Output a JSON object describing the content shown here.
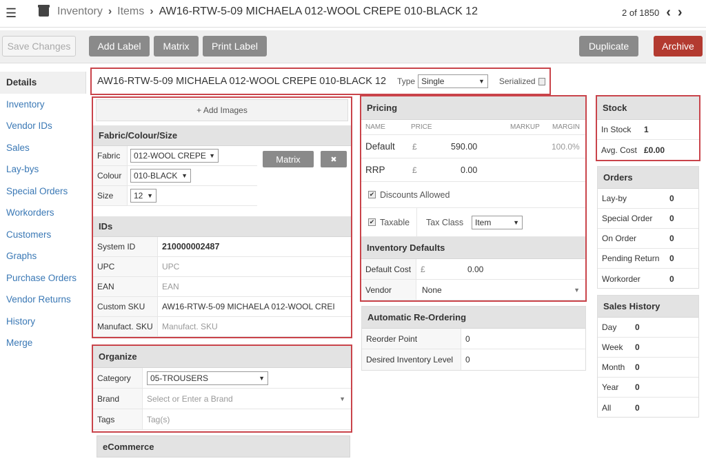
{
  "header": {
    "crumb_inventory": "Inventory",
    "crumb_items": "Items",
    "crumb_current": "AW16-RTW-5-09 MICHAELA 012-WOOL CREPE 010-BLACK 12",
    "pager": "2 of 1850"
  },
  "toolbar": {
    "save_label": "Save Changes",
    "add_label": "Add Label",
    "matrix_label": "Matrix",
    "print_label": "Print Label",
    "duplicate_label": "Duplicate",
    "archive_label": "Archive"
  },
  "sidebar": {
    "items": [
      {
        "label": "Details"
      },
      {
        "label": "Inventory"
      },
      {
        "label": "Vendor IDs"
      },
      {
        "label": "Sales"
      },
      {
        "label": "Lay-bys"
      },
      {
        "label": "Special Orders"
      },
      {
        "label": "Workorders"
      },
      {
        "label": "Customers"
      },
      {
        "label": "Graphs"
      },
      {
        "label": "Purchase Orders"
      },
      {
        "label": "Vendor Returns"
      },
      {
        "label": "History"
      },
      {
        "label": "Merge"
      }
    ]
  },
  "item": {
    "title": "AW16-RTW-5-09 MICHAELA 012-WOOL CREPE 010-BLACK 12",
    "type_label": "Type",
    "type_value": "Single",
    "serialized_label": "Serialized"
  },
  "images": {
    "add_label": "+ Add Images"
  },
  "fcs": {
    "title": "Fabric/Colour/Size",
    "fabric_label": "Fabric",
    "fabric_value": "012-WOOL CREPE",
    "colour_label": "Colour",
    "colour_value": "010-BLACK",
    "size_label": "Size",
    "size_value": "12",
    "matrix_button": "Matrix",
    "remove_button": "✖"
  },
  "ids": {
    "title": "IDs",
    "system_id_label": "System ID",
    "system_id_value": "210000002487",
    "upc_label": "UPC",
    "upc_placeholder": "UPC",
    "ean_label": "EAN",
    "ean_placeholder": "EAN",
    "custom_sku_label": "Custom SKU",
    "custom_sku_value": "AW16-RTW-5-09 MICHAELA 012-WOOL CREI",
    "manufact_sku_label": "Manufact. SKU",
    "manufact_sku_placeholder": "Manufact. SKU"
  },
  "organize": {
    "title": "Organize",
    "category_label": "Category",
    "category_value": "05-TROUSERS",
    "brand_label": "Brand",
    "brand_placeholder": "Select or Enter a Brand",
    "tags_label": "Tags",
    "tags_placeholder": "Tag(s)"
  },
  "ecommerce": {
    "title": "eCommerce"
  },
  "pricing": {
    "title": "Pricing",
    "col_name": "NAME",
    "col_price": "PRICE",
    "col_markup": "MARKUP",
    "col_margin": "MARGIN",
    "default_label": "Default",
    "currency": "£",
    "default_price": "590.00",
    "default_margin": "100.0%",
    "rrp_label": "RRP",
    "rrp_price": "0.00",
    "discounts_label": "Discounts Allowed",
    "taxable_label": "Taxable",
    "tax_class_label": "Tax Class",
    "tax_class_value": "Item"
  },
  "inv_defaults": {
    "title": "Inventory Defaults",
    "default_cost_label": "Default Cost",
    "default_cost_value": "0.00",
    "vendor_label": "Vendor",
    "vendor_value": "None"
  },
  "reorder": {
    "title": "Automatic Re-Ordering",
    "reorder_point_label": "Reorder Point",
    "reorder_point_value": "0",
    "desired_label": "Desired Inventory Level",
    "desired_value": "0"
  },
  "stock": {
    "title": "Stock",
    "in_stock_label": "In Stock",
    "in_stock_value": "1",
    "avg_cost_label": "Avg. Cost",
    "avg_cost_value": "£0.00"
  },
  "orders": {
    "title": "Orders",
    "rows": [
      {
        "label": "Lay-by",
        "value": "0"
      },
      {
        "label": "Special Order",
        "value": "0"
      },
      {
        "label": "On Order",
        "value": "0"
      },
      {
        "label": "Pending Return",
        "value": "0"
      },
      {
        "label": "Workorder",
        "value": "0"
      }
    ]
  },
  "sales_history": {
    "title": "Sales History",
    "rows": [
      {
        "label": "Day",
        "value": "0"
      },
      {
        "label": "Week",
        "value": "0"
      },
      {
        "label": "Month",
        "value": "0"
      },
      {
        "label": "Year",
        "value": "0"
      },
      {
        "label": "All",
        "value": "0"
      }
    ]
  }
}
